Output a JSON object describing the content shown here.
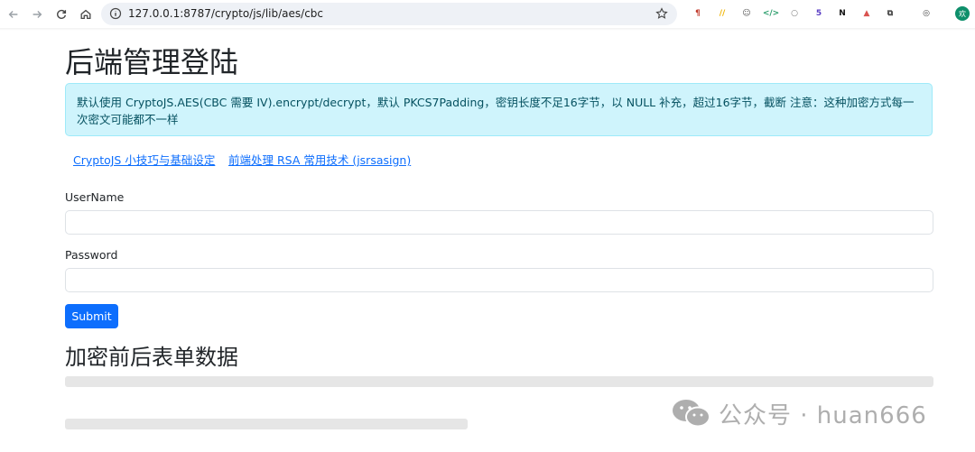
{
  "browser": {
    "url": "127.0.0.1:8787/crypto/js/lib/aes/cbc",
    "extensions": [
      {
        "name": "paragraph-ext-icon",
        "glyph": "¶",
        "color": "#c0392b"
      },
      {
        "name": "stripes-ext-icon",
        "glyph": "//",
        "color": "#f0b400"
      },
      {
        "name": "robot-ext-icon",
        "glyph": "☺",
        "color": "#555555"
      },
      {
        "name": "code-ext-icon",
        "glyph": "</>",
        "color": "#2a9d6b"
      },
      {
        "name": "circle-ext-icon",
        "glyph": "○",
        "color": "#7a7a7a"
      },
      {
        "name": "cube-ext-icon",
        "glyph": "5",
        "color": "#5b3fc4"
      },
      {
        "name": "notion-ext-icon",
        "glyph": "N",
        "color": "#111111"
      },
      {
        "name": "shield-ext-icon",
        "glyph": "▲",
        "color": "#d9534f"
      },
      {
        "name": "puzzle-ext-icon",
        "glyph": "⧉",
        "color": "#444444"
      },
      {
        "name": "screenshot-ext-icon",
        "glyph": "◎",
        "color": "#444444"
      }
    ],
    "profile_initial": "欢"
  },
  "page": {
    "title": "后端管理登陆",
    "alert_text": "默认使用 CryptoJS.AES(CBC 需要 IV).encrypt/decrypt，默认 PKCS7Padding，密钥长度不足16字节，以 NULL 补充，超过16字节，截断 注意：这种加密方式每一次密文可能都不一样",
    "links": [
      "CryptoJS 小技巧与基础设定",
      "前端处理 RSA 常用技术 (jsrsasign)"
    ],
    "username_label": "UserName",
    "username_value": "",
    "password_label": "Password",
    "password_value": "",
    "submit_label": "Submit",
    "section_title": "加密前后表单数据"
  },
  "watermark": {
    "text": "公众号 · huan666"
  },
  "colors": {
    "alert_bg": "#cff4fc",
    "alert_text": "#055160",
    "link": "#0d6efd",
    "button": "#0d6efd"
  }
}
